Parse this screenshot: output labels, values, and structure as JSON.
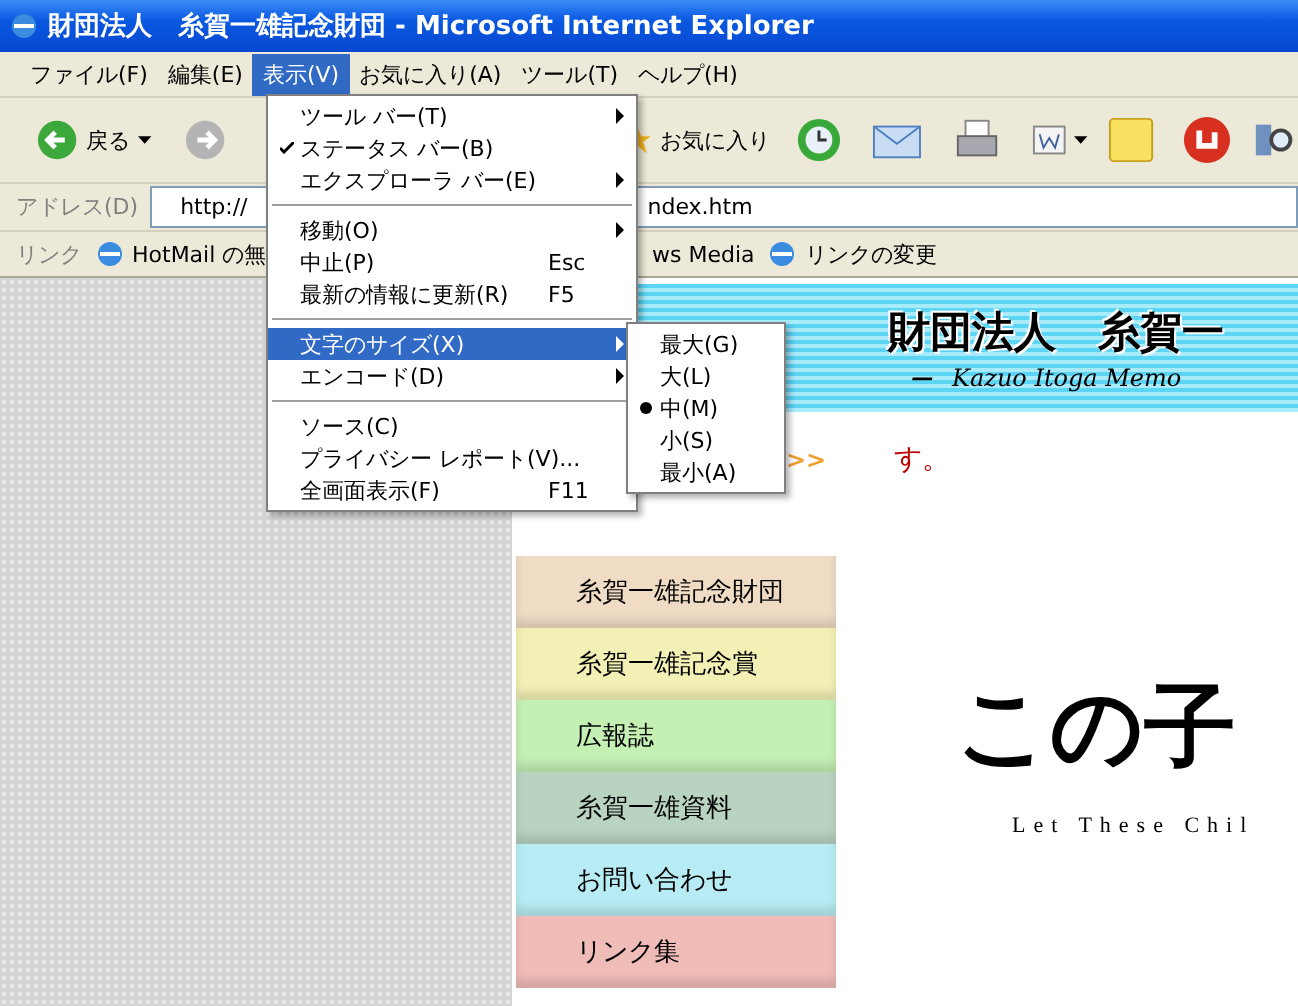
{
  "window": {
    "title": "財団法人　糸賀一雄記念財団 - Microsoft Internet Explorer"
  },
  "menu_bar": [
    {
      "label": "ファイル(F)",
      "selected": false
    },
    {
      "label": "編集(E)",
      "selected": false
    },
    {
      "label": "表示(V)",
      "selected": true
    },
    {
      "label": "お気に入り(A)",
      "selected": false
    },
    {
      "label": "ツール(T)",
      "selected": false
    },
    {
      "label": "ヘルプ(H)",
      "selected": false
    }
  ],
  "toolbar": {
    "back_label": "戻る",
    "favorites_label": "お気に入り"
  },
  "address_bar": {
    "label": "アドレス(D)",
    "value_start": "http://",
    "value_end": "ndex.htm"
  },
  "links_bar": {
    "label": "リンク",
    "items": [
      {
        "label": "HotMail の無",
        "icon": true
      },
      {
        "label": "ws Media",
        "icon": false
      },
      {
        "label": "リンクの変更",
        "icon": true
      }
    ]
  },
  "view_menu": {
    "groups": [
      [
        {
          "label": "ツール バー(T)",
          "checked": false,
          "submenu": true,
          "selected": false
        },
        {
          "label": "ステータス バー(B)",
          "checked": true,
          "submenu": false,
          "selected": false
        },
        {
          "label": "エクスプローラ バー(E)",
          "checked": false,
          "submenu": true,
          "selected": false
        }
      ],
      [
        {
          "label": "移動(O)",
          "checked": false,
          "submenu": true,
          "selected": false
        },
        {
          "label": "中止(P)",
          "shortcut": "Esc",
          "checked": false,
          "submenu": false,
          "selected": false
        },
        {
          "label": "最新の情報に更新(R)",
          "shortcut": "F5",
          "checked": false,
          "submenu": false,
          "selected": false
        }
      ],
      [
        {
          "label": "文字のサイズ(X)",
          "checked": false,
          "submenu": true,
          "selected": true
        },
        {
          "label": "エンコード(D)",
          "checked": false,
          "submenu": true,
          "selected": false
        }
      ],
      [
        {
          "label": "ソース(C)",
          "checked": false,
          "submenu": false,
          "selected": false
        },
        {
          "label": "プライバシー レポート(V)...",
          "checked": false,
          "submenu": false,
          "selected": false
        },
        {
          "label": "全画面表示(F)",
          "shortcut": "F11",
          "checked": false,
          "submenu": false,
          "selected": false
        }
      ]
    ]
  },
  "text_size_menu": [
    {
      "label": "最大(G)",
      "selected": false
    },
    {
      "label": "大(L)",
      "selected": false
    },
    {
      "label": "中(M)",
      "selected": true
    },
    {
      "label": "小(S)",
      "selected": false
    },
    {
      "label": "最小(A)",
      "selected": false
    }
  ],
  "banner": {
    "title": "財団法人　糸賀一",
    "dash": "ー",
    "subtitle": "Kazuo Itoga Memo"
  },
  "notice": {
    "arrow": ">>",
    "text": "す。"
  },
  "nav": [
    {
      "label": "糸賀一雄記念財団",
      "color": "#f0dcc4"
    },
    {
      "label": "糸賀一雄記念賞",
      "color": "#f2f0b4"
    },
    {
      "label": "広報誌",
      "color": "#c4f0b4"
    },
    {
      "label": "糸賀一雄資料",
      "color": "#b8d4c0"
    },
    {
      "label": "お問い合わせ",
      "color": "#b8ecf4"
    },
    {
      "label": "リンク集",
      "color": "#f0bcb8"
    }
  ],
  "hero": {
    "calligraphy": "この子",
    "tagline": "Let These Chil"
  }
}
